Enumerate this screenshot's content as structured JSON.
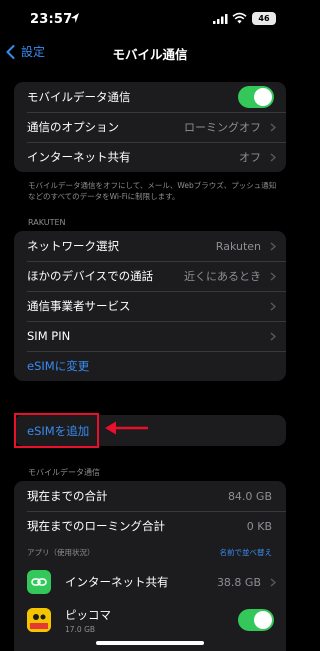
{
  "status_bar": {
    "time": "23:57",
    "battery": "46"
  },
  "nav": {
    "back_label": "設定",
    "title": "モバイル通信"
  },
  "group1": {
    "mobile_data_label": "モバイルデータ通信",
    "options_label": "通信のオプション",
    "options_value": "ローミングオフ",
    "hotspot_label": "インターネット共有",
    "hotspot_value": "オフ"
  },
  "group1_note": "モバイルデータ通信をオフにして、メール、Webブラウズ、プッシュ通知などのすべてのデータをWi-Fiに制限します。",
  "carrier_section": "RAKUTEN",
  "carrier": {
    "network_label": "ネットワーク選択",
    "network_value": "Rakuten",
    "other_devices_label": "ほかのデバイスでの通話",
    "other_devices_value": "近くにあるとき",
    "carrier_services_label": "通信事業者サービス",
    "sim_pin_label": "SIM PIN",
    "esim_change_label": "eSIMに変更"
  },
  "esim_add_label": "eSIMを追加",
  "usage_section": "モバイルデータ通信",
  "usage": {
    "current_total_label": "現在までの合計",
    "current_total_value": "84.0 GB",
    "roaming_total_label": "現在までのローミング合計",
    "roaming_total_value": "0 KB",
    "apps_header": "アプリ（使用状況）",
    "sort_label": "名前で並べ替え",
    "apps": [
      {
        "name": "インターネット共有",
        "value": "38.8 GB"
      },
      {
        "name": "ピッコマ",
        "sub": "17.0 GB"
      }
    ]
  },
  "colors": {
    "accent": "#3a8bf0",
    "toggle_on": "#34c759",
    "highlight": "#e8102a"
  }
}
